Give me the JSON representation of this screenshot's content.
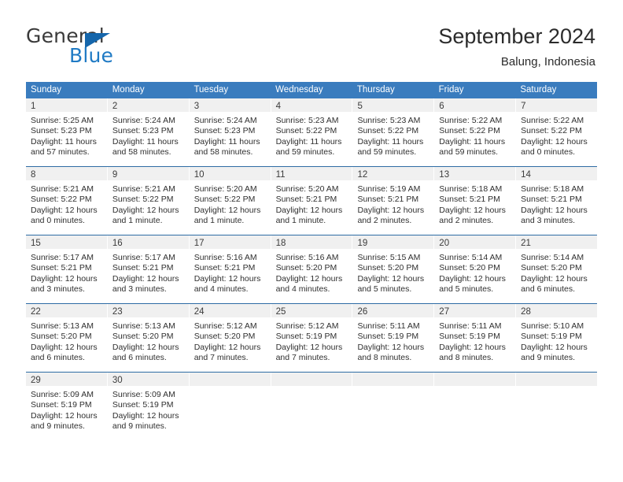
{
  "logo": {
    "word_one": "General",
    "word_two": "Blue",
    "triangle_color": "#1566ab",
    "blue_color": "#1f7ac4"
  },
  "header": {
    "title": "September 2024",
    "subtitle": "Balung, Indonesia"
  },
  "theme": {
    "header_band": "#3a7cbe",
    "row_divider": "#2e6ca4",
    "daynum_band": "#f0f0f0",
    "text": "#2f2f2f"
  },
  "weekdays": [
    "Sunday",
    "Monday",
    "Tuesday",
    "Wednesday",
    "Thursday",
    "Friday",
    "Saturday"
  ],
  "weeks": [
    [
      {
        "day": "1",
        "sunrise": "Sunrise: 5:25 AM",
        "sunset": "Sunset: 5:23 PM",
        "daylight_1": "Daylight: 11 hours",
        "daylight_2": "and 57 minutes."
      },
      {
        "day": "2",
        "sunrise": "Sunrise: 5:24 AM",
        "sunset": "Sunset: 5:23 PM",
        "daylight_1": "Daylight: 11 hours",
        "daylight_2": "and 58 minutes."
      },
      {
        "day": "3",
        "sunrise": "Sunrise: 5:24 AM",
        "sunset": "Sunset: 5:23 PM",
        "daylight_1": "Daylight: 11 hours",
        "daylight_2": "and 58 minutes."
      },
      {
        "day": "4",
        "sunrise": "Sunrise: 5:23 AM",
        "sunset": "Sunset: 5:22 PM",
        "daylight_1": "Daylight: 11 hours",
        "daylight_2": "and 59 minutes."
      },
      {
        "day": "5",
        "sunrise": "Sunrise: 5:23 AM",
        "sunset": "Sunset: 5:22 PM",
        "daylight_1": "Daylight: 11 hours",
        "daylight_2": "and 59 minutes."
      },
      {
        "day": "6",
        "sunrise": "Sunrise: 5:22 AM",
        "sunset": "Sunset: 5:22 PM",
        "daylight_1": "Daylight: 11 hours",
        "daylight_2": "and 59 minutes."
      },
      {
        "day": "7",
        "sunrise": "Sunrise: 5:22 AM",
        "sunset": "Sunset: 5:22 PM",
        "daylight_1": "Daylight: 12 hours",
        "daylight_2": "and 0 minutes."
      }
    ],
    [
      {
        "day": "8",
        "sunrise": "Sunrise: 5:21 AM",
        "sunset": "Sunset: 5:22 PM",
        "daylight_1": "Daylight: 12 hours",
        "daylight_2": "and 0 minutes."
      },
      {
        "day": "9",
        "sunrise": "Sunrise: 5:21 AM",
        "sunset": "Sunset: 5:22 PM",
        "daylight_1": "Daylight: 12 hours",
        "daylight_2": "and 1 minute."
      },
      {
        "day": "10",
        "sunrise": "Sunrise: 5:20 AM",
        "sunset": "Sunset: 5:22 PM",
        "daylight_1": "Daylight: 12 hours",
        "daylight_2": "and 1 minute."
      },
      {
        "day": "11",
        "sunrise": "Sunrise: 5:20 AM",
        "sunset": "Sunset: 5:21 PM",
        "daylight_1": "Daylight: 12 hours",
        "daylight_2": "and 1 minute."
      },
      {
        "day": "12",
        "sunrise": "Sunrise: 5:19 AM",
        "sunset": "Sunset: 5:21 PM",
        "daylight_1": "Daylight: 12 hours",
        "daylight_2": "and 2 minutes."
      },
      {
        "day": "13",
        "sunrise": "Sunrise: 5:18 AM",
        "sunset": "Sunset: 5:21 PM",
        "daylight_1": "Daylight: 12 hours",
        "daylight_2": "and 2 minutes."
      },
      {
        "day": "14",
        "sunrise": "Sunrise: 5:18 AM",
        "sunset": "Sunset: 5:21 PM",
        "daylight_1": "Daylight: 12 hours",
        "daylight_2": "and 3 minutes."
      }
    ],
    [
      {
        "day": "15",
        "sunrise": "Sunrise: 5:17 AM",
        "sunset": "Sunset: 5:21 PM",
        "daylight_1": "Daylight: 12 hours",
        "daylight_2": "and 3 minutes."
      },
      {
        "day": "16",
        "sunrise": "Sunrise: 5:17 AM",
        "sunset": "Sunset: 5:21 PM",
        "daylight_1": "Daylight: 12 hours",
        "daylight_2": "and 3 minutes."
      },
      {
        "day": "17",
        "sunrise": "Sunrise: 5:16 AM",
        "sunset": "Sunset: 5:21 PM",
        "daylight_1": "Daylight: 12 hours",
        "daylight_2": "and 4 minutes."
      },
      {
        "day": "18",
        "sunrise": "Sunrise: 5:16 AM",
        "sunset": "Sunset: 5:20 PM",
        "daylight_1": "Daylight: 12 hours",
        "daylight_2": "and 4 minutes."
      },
      {
        "day": "19",
        "sunrise": "Sunrise: 5:15 AM",
        "sunset": "Sunset: 5:20 PM",
        "daylight_1": "Daylight: 12 hours",
        "daylight_2": "and 5 minutes."
      },
      {
        "day": "20",
        "sunrise": "Sunrise: 5:14 AM",
        "sunset": "Sunset: 5:20 PM",
        "daylight_1": "Daylight: 12 hours",
        "daylight_2": "and 5 minutes."
      },
      {
        "day": "21",
        "sunrise": "Sunrise: 5:14 AM",
        "sunset": "Sunset: 5:20 PM",
        "daylight_1": "Daylight: 12 hours",
        "daylight_2": "and 6 minutes."
      }
    ],
    [
      {
        "day": "22",
        "sunrise": "Sunrise: 5:13 AM",
        "sunset": "Sunset: 5:20 PM",
        "daylight_1": "Daylight: 12 hours",
        "daylight_2": "and 6 minutes."
      },
      {
        "day": "23",
        "sunrise": "Sunrise: 5:13 AM",
        "sunset": "Sunset: 5:20 PM",
        "daylight_1": "Daylight: 12 hours",
        "daylight_2": "and 6 minutes."
      },
      {
        "day": "24",
        "sunrise": "Sunrise: 5:12 AM",
        "sunset": "Sunset: 5:20 PM",
        "daylight_1": "Daylight: 12 hours",
        "daylight_2": "and 7 minutes."
      },
      {
        "day": "25",
        "sunrise": "Sunrise: 5:12 AM",
        "sunset": "Sunset: 5:19 PM",
        "daylight_1": "Daylight: 12 hours",
        "daylight_2": "and 7 minutes."
      },
      {
        "day": "26",
        "sunrise": "Sunrise: 5:11 AM",
        "sunset": "Sunset: 5:19 PM",
        "daylight_1": "Daylight: 12 hours",
        "daylight_2": "and 8 minutes."
      },
      {
        "day": "27",
        "sunrise": "Sunrise: 5:11 AM",
        "sunset": "Sunset: 5:19 PM",
        "daylight_1": "Daylight: 12 hours",
        "daylight_2": "and 8 minutes."
      },
      {
        "day": "28",
        "sunrise": "Sunrise: 5:10 AM",
        "sunset": "Sunset: 5:19 PM",
        "daylight_1": "Daylight: 12 hours",
        "daylight_2": "and 9 minutes."
      }
    ],
    [
      {
        "day": "29",
        "sunrise": "Sunrise: 5:09 AM",
        "sunset": "Sunset: 5:19 PM",
        "daylight_1": "Daylight: 12 hours",
        "daylight_2": "and 9 minutes."
      },
      {
        "day": "30",
        "sunrise": "Sunrise: 5:09 AM",
        "sunset": "Sunset: 5:19 PM",
        "daylight_1": "Daylight: 12 hours",
        "daylight_2": "and 9 minutes."
      },
      {
        "day": "",
        "sunrise": "",
        "sunset": "",
        "daylight_1": "",
        "daylight_2": ""
      },
      {
        "day": "",
        "sunrise": "",
        "sunset": "",
        "daylight_1": "",
        "daylight_2": ""
      },
      {
        "day": "",
        "sunrise": "",
        "sunset": "",
        "daylight_1": "",
        "daylight_2": ""
      },
      {
        "day": "",
        "sunrise": "",
        "sunset": "",
        "daylight_1": "",
        "daylight_2": ""
      },
      {
        "day": "",
        "sunrise": "",
        "sunset": "",
        "daylight_1": "",
        "daylight_2": ""
      }
    ]
  ]
}
